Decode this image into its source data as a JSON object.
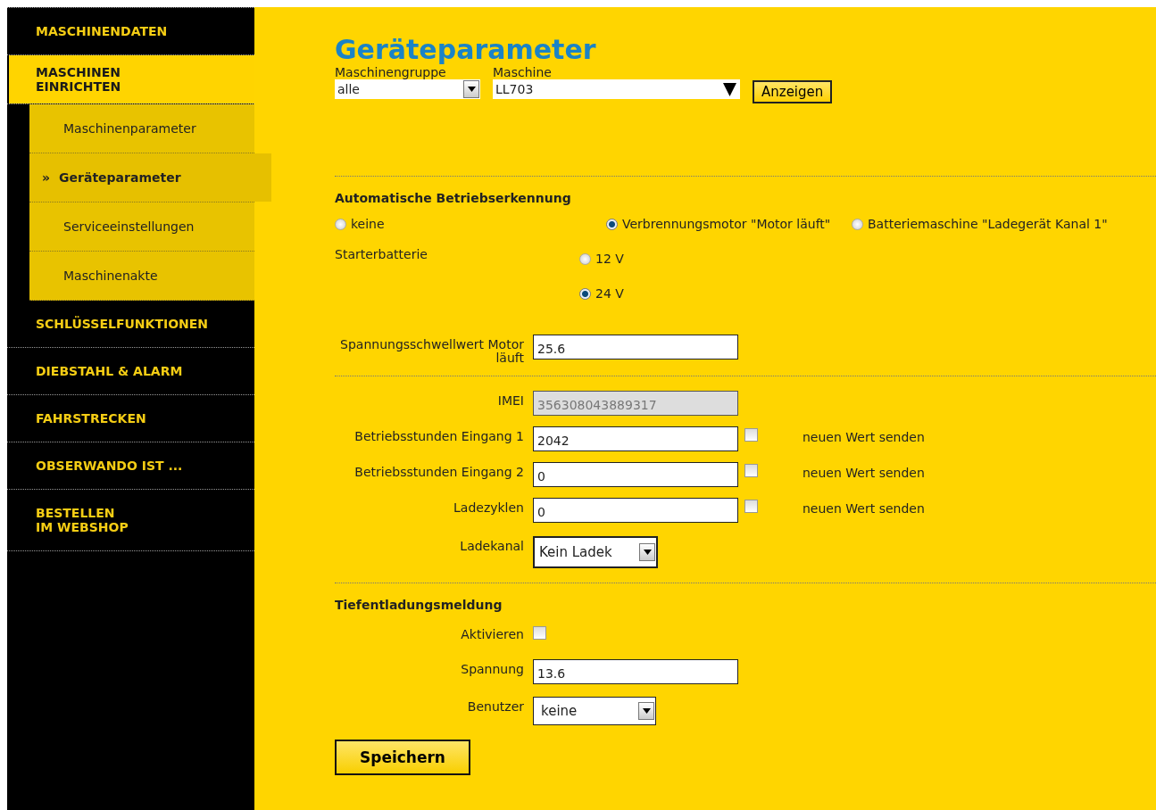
{
  "sidebar": {
    "items": [
      {
        "label": "MASCHINENDATEN",
        "selected": false
      },
      {
        "label": "MASCHINEN\nEINRICHTEN",
        "selected": true,
        "children": [
          {
            "label": "Maschinenparameter",
            "selected": false
          },
          {
            "label": "Geräteparameter",
            "selected": true,
            "marker": "»"
          },
          {
            "label": "Serviceeinstellungen",
            "selected": false
          },
          {
            "label": "Maschinenakte",
            "selected": false
          }
        ]
      },
      {
        "label": "SCHLÜSSELFUNKTIONEN",
        "selected": false
      },
      {
        "label": "DIEBSTAHL & ALARM",
        "selected": false
      },
      {
        "label": "FAHRSTRECKEN",
        "selected": false
      },
      {
        "label": "OBSERWANDO IST ...",
        "selected": false
      },
      {
        "label": "BESTELLEN\nIM WEBSHOP",
        "selected": false
      }
    ]
  },
  "page_title": "Geräteparameter",
  "filters": {
    "group": {
      "label": "Maschinengruppe",
      "value": "alle"
    },
    "machine": {
      "label": "Maschine",
      "value": "LL703"
    },
    "button": "Anzeigen"
  },
  "detection": {
    "title": "Automatische Betriebserkennung",
    "options": [
      {
        "label": "keine",
        "selected": false
      },
      {
        "label": "Verbrennungsmotor \"Motor läuft\"",
        "selected": true
      },
      {
        "label": "Batteriemaschine \"Ladegerät Kanal 1\"",
        "selected": false
      }
    ],
    "starter": {
      "label": "Starterbatterie",
      "options": [
        {
          "label": "12 V",
          "selected": false
        },
        {
          "label": "24 V",
          "selected": true
        }
      ]
    },
    "threshold": {
      "label": "Spannungsschwellwert Motor läuft",
      "value": "25.6"
    }
  },
  "counters": {
    "imei": {
      "label": "IMEI",
      "value": "356308043889317",
      "disabled": true
    },
    "rows": [
      {
        "label": "Betriebsstunden Eingang 1",
        "value": "2042",
        "checked": false,
        "send_label": "neuen Wert senden"
      },
      {
        "label": "Betriebsstunden Eingang 2",
        "value": "0",
        "checked": false,
        "send_label": "neuen Wert senden"
      },
      {
        "label": "Ladezyklen",
        "value": "0",
        "checked": false,
        "send_label": "neuen Wert senden"
      }
    ],
    "channel": {
      "label": "Ladekanal",
      "value": "Kein Ladek"
    }
  },
  "deep_discharge": {
    "title": "Tiefentladungsmeldung",
    "activate": {
      "label": "Aktivieren",
      "checked": false
    },
    "voltage": {
      "label": "Spannung",
      "value": "13.6"
    },
    "user": {
      "label": "Benutzer",
      "value": "keine"
    }
  },
  "save_button": "Speichern"
}
